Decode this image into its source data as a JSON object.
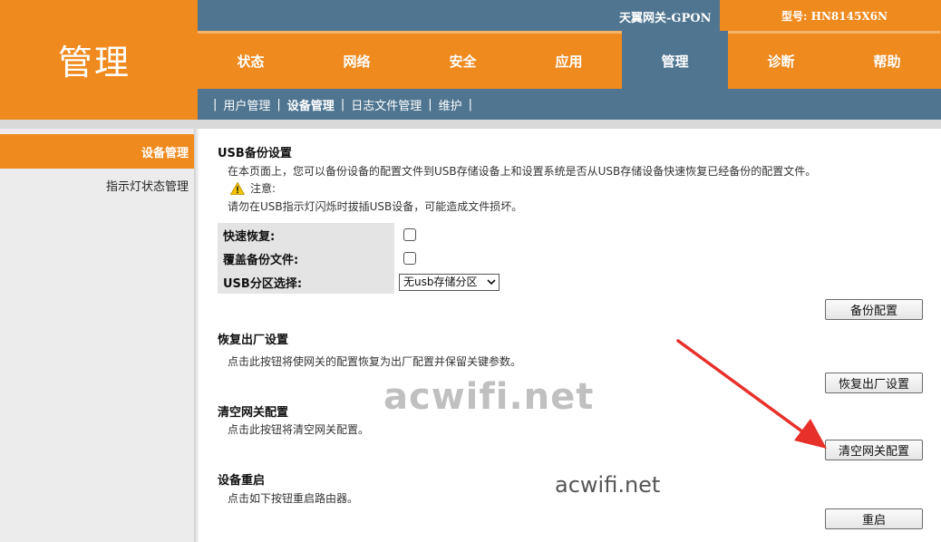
{
  "brand": {
    "title": "管理"
  },
  "infobar": {
    "product": "天翼网关-GPON",
    "model": "型号: HN8145X6N"
  },
  "main_nav": {
    "tabs": [
      {
        "label": "状态",
        "active": false
      },
      {
        "label": "网络",
        "active": false
      },
      {
        "label": "安全",
        "active": false
      },
      {
        "label": "应用",
        "active": false
      },
      {
        "label": "管理",
        "active": true
      },
      {
        "label": "诊断",
        "active": false
      },
      {
        "label": "帮助",
        "active": false
      }
    ]
  },
  "sub_nav": {
    "items": [
      {
        "label": "用户管理",
        "active": false
      },
      {
        "label": "设备管理",
        "active": true
      },
      {
        "label": "日志文件管理",
        "active": false
      },
      {
        "label": "维护",
        "active": false
      }
    ]
  },
  "sidebar": {
    "items": [
      {
        "label": "设备管理",
        "active": true
      },
      {
        "label": "指示灯状态管理",
        "active": false
      }
    ]
  },
  "usb_backup": {
    "title": "USB备份设置",
    "description": "在本页面上，您可以备份设备的配置文件到USB存储设备上和设置系统是否从USB存储设备快速恢复已经备份的配置文件。",
    "warning_label": "注意:",
    "warning_text": "请勿在USB指示灯闪烁时拔插USB设备，可能造成文件损坏。",
    "fast_restore_label": "快速恢复:",
    "fast_restore_checked": false,
    "overwrite_label": "覆盖备份文件:",
    "overwrite_checked": false,
    "partition_label": "USB分区选择:",
    "partition_selected": "无usb存储分区",
    "backup_button": "备份配置"
  },
  "factory_reset": {
    "title": "恢复出厂设置",
    "description": "点击此按钮将使网关的配置恢复为出厂配置并保留关键参数。",
    "button": "恢复出厂设置"
  },
  "clear_config": {
    "title": "清空网关配置",
    "description": "点击此按钮将清空网关配置。",
    "button": "清空网关配置"
  },
  "reboot": {
    "title": "设备重启",
    "description": "点击如下按钮重启路由器。",
    "button": "重启"
  },
  "watermarks": [
    "acwifi.net",
    "acwifi.net"
  ],
  "colors": {
    "orange": "#ef8a1f",
    "steel_blue": "#4f7591",
    "arrow_red": "#e8302a"
  }
}
